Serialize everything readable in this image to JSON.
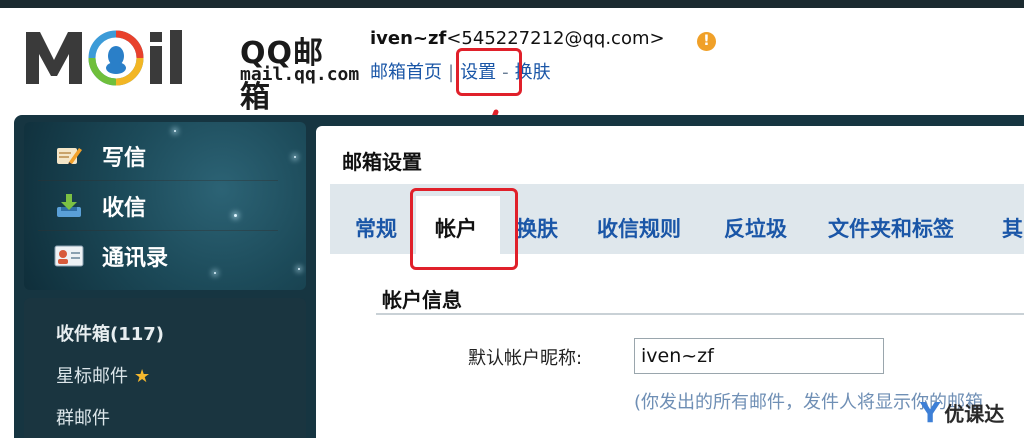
{
  "logo": {
    "mark": "Mail",
    "brand": "QQ邮箱",
    "domain": "mail.qq.com"
  },
  "user": {
    "name": "iven~zf",
    "email": "<545227212@qq.com>"
  },
  "top_nav": {
    "home": "邮箱首页",
    "separator": "|",
    "settings": "设置",
    "dash": "-",
    "skin": "换肤"
  },
  "sidebar": {
    "actions": [
      {
        "label": "写信",
        "icon": "compose-icon"
      },
      {
        "label": "收信",
        "icon": "inbox-download-icon"
      },
      {
        "label": "通讯录",
        "icon": "contacts-icon"
      }
    ],
    "folders": [
      {
        "label": "收件箱(117)"
      },
      {
        "label": "星标邮件",
        "icon": "star-icon"
      },
      {
        "label": "群邮件"
      }
    ]
  },
  "main": {
    "title": "邮箱设置",
    "tabs": [
      {
        "label": "常规"
      },
      {
        "label": "帐户",
        "active": true
      },
      {
        "label": "换肤"
      },
      {
        "label": "收信规则"
      },
      {
        "label": "反垃圾"
      },
      {
        "label": "文件夹和标签"
      },
      {
        "label": "其"
      }
    ],
    "section_title": "帐户信息",
    "nickname_label": "默认帐户昵称:",
    "nickname_value": "iven~zf",
    "hint": "(你发出的所有邮件，发件人将显示你的邮箱"
  },
  "watermark": {
    "symbol": "Y",
    "text": "优课达"
  },
  "colors": {
    "link": "#1a56a7",
    "highlight": "#e0202a",
    "sidebar": "#163541",
    "tabbar": "#dfe7ec"
  }
}
